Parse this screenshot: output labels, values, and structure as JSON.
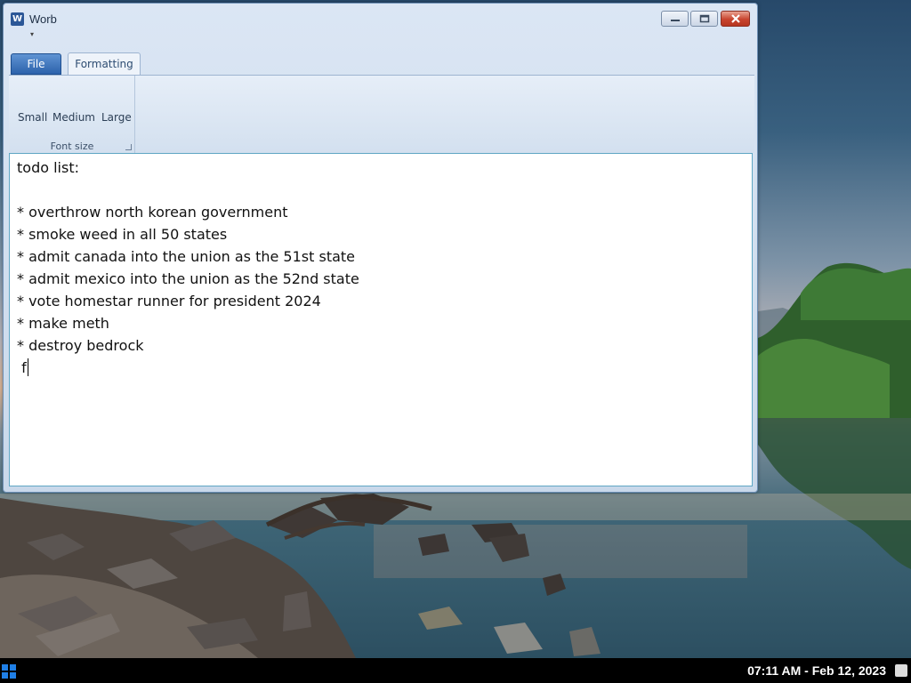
{
  "window": {
    "title": "Worb",
    "app_icon_letter": "W",
    "controls": {
      "minimize": "minimize-icon",
      "maximize": "restore-icon",
      "close": "close-icon"
    }
  },
  "ribbon": {
    "tabs": [
      {
        "label": "File",
        "active": false
      },
      {
        "label": "Formatting",
        "active": true
      }
    ],
    "groups": [
      {
        "label": "Font size",
        "buttons": [
          "Small",
          "Medium",
          "Large"
        ]
      }
    ]
  },
  "editor": {
    "lines": [
      "todo list:",
      "",
      "* overthrow north korean government",
      "* smoke weed in all 50 states",
      "* admit canada into the union as the 51st state",
      "* admit mexico into the union as the 52nd state",
      "* vote homestar runner for president 2024",
      "* make meth",
      "* destroy bedrock",
      " f"
    ]
  },
  "taskbar": {
    "clock": "07:11 AM - Feb 12, 2023",
    "start_icon": "windows-logo-icon",
    "notification_icon": "notification-icon"
  },
  "colors": {
    "start_blue": "#1f7fe6",
    "file_tab": "#2c62ab",
    "close_red": "#c8442e",
    "editor_border": "#5fa6c4"
  }
}
